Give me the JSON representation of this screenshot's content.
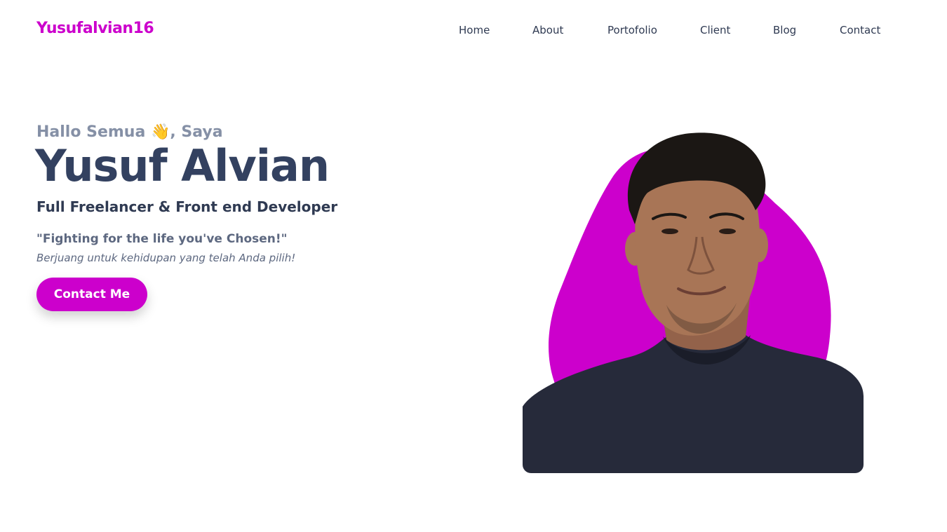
{
  "brand": {
    "name": "Yusufalvian16",
    "accent_color": "#cc00cc"
  },
  "nav": {
    "items": [
      {
        "label": "Home"
      },
      {
        "label": "About"
      },
      {
        "label": "Portofolio"
      },
      {
        "label": "Client"
      },
      {
        "label": "Blog"
      },
      {
        "label": "Contact"
      }
    ]
  },
  "hero": {
    "greeting": "Hallo Semua 👋, Saya",
    "name": "Yusuf Alvian",
    "role": "Full Freelancer & Front end Developer",
    "quote": "\"Fighting for the life you've Chosen!\"",
    "quote_translation": "Berjuang untuk kehidupan yang telah Anda pilih!",
    "cta_label": "Contact Me"
  },
  "portrait": {
    "blob_color": "#cc00cc",
    "shirt_color": "#262a3a",
    "skin_color": "#a87556",
    "hair_color": "#1b1714"
  }
}
